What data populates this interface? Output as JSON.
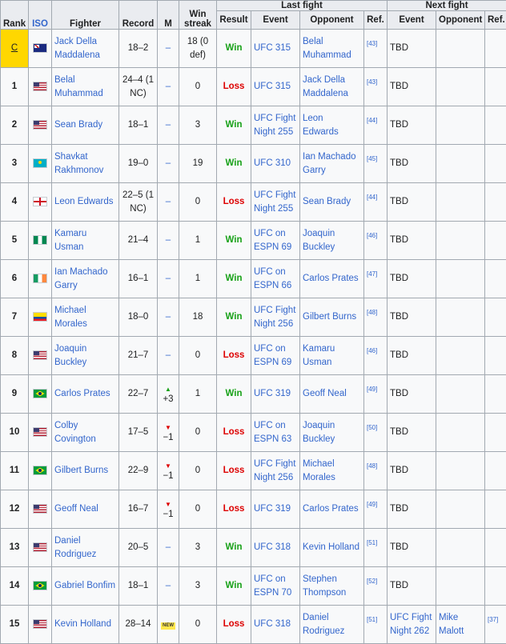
{
  "headers": {
    "rank": "Rank",
    "iso": "ISO",
    "fighter": "Fighter",
    "record": "Record",
    "m": "M",
    "win_streak": "Win streak",
    "last_fight": "Last fight",
    "next_fight": "Next fight",
    "result": "Result",
    "event": "Event",
    "opponent": "Opponent",
    "ref": "Ref.",
    "next_event": "Event",
    "next_opponent": "Opponent",
    "next_ref": "Ref."
  },
  "rows": [
    {
      "rank": "C",
      "iso": "AUS",
      "fighter": "Jack Della Maddalena",
      "record": "18–2",
      "m": "–",
      "m_type": "dash",
      "streak": "18 (0 def)",
      "result": "Win",
      "event": "UFC 315",
      "opponent": "Belal Muhammad",
      "ref": "[43]",
      "next_event": "TBD",
      "next_opponent": "",
      "next_ref": ""
    },
    {
      "rank": "1",
      "iso": "USA",
      "fighter": "Belal Muhammad",
      "record": "24–4 (1 NC)",
      "m": "–",
      "m_type": "dash",
      "streak": "0",
      "result": "Loss",
      "event": "UFC 315",
      "opponent": "Jack Della Maddalena",
      "ref": "[43]",
      "next_event": "TBD",
      "next_opponent": "",
      "next_ref": ""
    },
    {
      "rank": "2",
      "iso": "USA",
      "fighter": "Sean Brady",
      "record": "18–1",
      "m": "–",
      "m_type": "dash",
      "streak": "3",
      "result": "Win",
      "event": "UFC Fight Night 255",
      "opponent": "Leon Edwards",
      "ref": "[44]",
      "next_event": "TBD",
      "next_opponent": "",
      "next_ref": ""
    },
    {
      "rank": "3",
      "iso": "KAZ",
      "fighter": "Shavkat Rakhmonov",
      "record": "19–0",
      "m": "–",
      "m_type": "dash",
      "streak": "19",
      "result": "Win",
      "event": "UFC 310",
      "opponent": "Ian Machado Garry",
      "ref": "[45]",
      "next_event": "TBD",
      "next_opponent": "",
      "next_ref": ""
    },
    {
      "rank": "4",
      "iso": "ENG",
      "fighter": "Leon Edwards",
      "record": "22–5 (1 NC)",
      "m": "–",
      "m_type": "dash",
      "streak": "0",
      "result": "Loss",
      "event": "UFC Fight Night 255",
      "opponent": "Sean Brady",
      "ref": "[44]",
      "next_event": "TBD",
      "next_opponent": "",
      "next_ref": ""
    },
    {
      "rank": "5",
      "iso": "NGA",
      "fighter": "Kamaru Usman",
      "record": "21–4",
      "m": "–",
      "m_type": "dash",
      "streak": "1",
      "result": "Win",
      "event": "UFC on ESPN 69",
      "opponent": "Joaquin Buckley",
      "ref": "[46]",
      "next_event": "TBD",
      "next_opponent": "",
      "next_ref": ""
    },
    {
      "rank": "6",
      "iso": "IRL",
      "fighter": "Ian Machado Garry",
      "record": "16–1",
      "m": "–",
      "m_type": "dash",
      "streak": "1",
      "result": "Win",
      "event": "UFC on ESPN 66",
      "opponent": "Carlos Prates",
      "ref": "[47]",
      "next_event": "TBD",
      "next_opponent": "",
      "next_ref": ""
    },
    {
      "rank": "7",
      "iso": "ECU",
      "fighter": "Michael Morales",
      "record": "18–0",
      "m": "–",
      "m_type": "dash",
      "streak": "18",
      "result": "Win",
      "event": "UFC Fight Night 256",
      "opponent": "Gilbert Burns",
      "ref": "[48]",
      "next_event": "TBD",
      "next_opponent": "",
      "next_ref": ""
    },
    {
      "rank": "8",
      "iso": "USA",
      "fighter": "Joaquin Buckley",
      "record": "21–7",
      "m": "–",
      "m_type": "dash",
      "streak": "0",
      "result": "Loss",
      "event": "UFC on ESPN 69",
      "opponent": "Kamaru Usman",
      "ref": "[46]",
      "next_event": "TBD",
      "next_opponent": "",
      "next_ref": ""
    },
    {
      "rank": "9",
      "iso": "BRA",
      "fighter": "Carlos Prates",
      "record": "22–7",
      "m": "+3",
      "m_type": "up",
      "streak": "1",
      "result": "Win",
      "event": "UFC 319",
      "opponent": "Geoff Neal",
      "ref": "[49]",
      "next_event": "TBD",
      "next_opponent": "",
      "next_ref": ""
    },
    {
      "rank": "10",
      "iso": "USA",
      "fighter": "Colby Covington",
      "record": "17–5",
      "m": "−1",
      "m_type": "down",
      "streak": "0",
      "result": "Loss",
      "event": "UFC on ESPN 63",
      "opponent": "Joaquin Buckley",
      "ref": "[50]",
      "next_event": "TBD",
      "next_opponent": "",
      "next_ref": ""
    },
    {
      "rank": "11",
      "iso": "BRA",
      "fighter": "Gilbert Burns",
      "record": "22–9",
      "m": "−1",
      "m_type": "down",
      "streak": "0",
      "result": "Loss",
      "event": "UFC Fight Night 256",
      "opponent": "Michael Morales",
      "ref": "[48]",
      "next_event": "TBD",
      "next_opponent": "",
      "next_ref": ""
    },
    {
      "rank": "12",
      "iso": "USA",
      "fighter": "Geoff Neal",
      "record": "16–7",
      "m": "−1",
      "m_type": "down",
      "streak": "0",
      "result": "Loss",
      "event": "UFC 319",
      "opponent": "Carlos Prates",
      "ref": "[49]",
      "next_event": "TBD",
      "next_opponent": "",
      "next_ref": ""
    },
    {
      "rank": "13",
      "iso": "USA",
      "fighter": "Daniel Rodriguez",
      "record": "20–5",
      "m": "–",
      "m_type": "dash",
      "streak": "3",
      "result": "Win",
      "event": "UFC 318",
      "opponent": "Kevin Holland",
      "ref": "[51]",
      "next_event": "TBD",
      "next_opponent": "",
      "next_ref": ""
    },
    {
      "rank": "14",
      "iso": "BRA",
      "fighter": "Gabriel Bonfim",
      "record": "18–1",
      "m": "–",
      "m_type": "dash",
      "streak": "3",
      "result": "Win",
      "event": "UFC on ESPN 70",
      "opponent": "Stephen Thompson",
      "ref": "[52]",
      "next_event": "TBD",
      "next_opponent": "",
      "next_ref": ""
    },
    {
      "rank": "15",
      "iso": "USA",
      "fighter": "Kevin Holland",
      "record": "28–14",
      "m": "NEW",
      "m_type": "new",
      "streak": "0",
      "result": "Loss",
      "event": "UFC 318",
      "opponent": "Daniel Rodriguez",
      "ref": "[51]",
      "next_event": "UFC Fight Night 262",
      "next_opponent": "Mike Malott",
      "next_ref": "[37]"
    }
  ],
  "colors": {
    "win": "#18a118",
    "loss": "#dd0000",
    "link": "#3366cc",
    "champion": "#ffd700"
  }
}
